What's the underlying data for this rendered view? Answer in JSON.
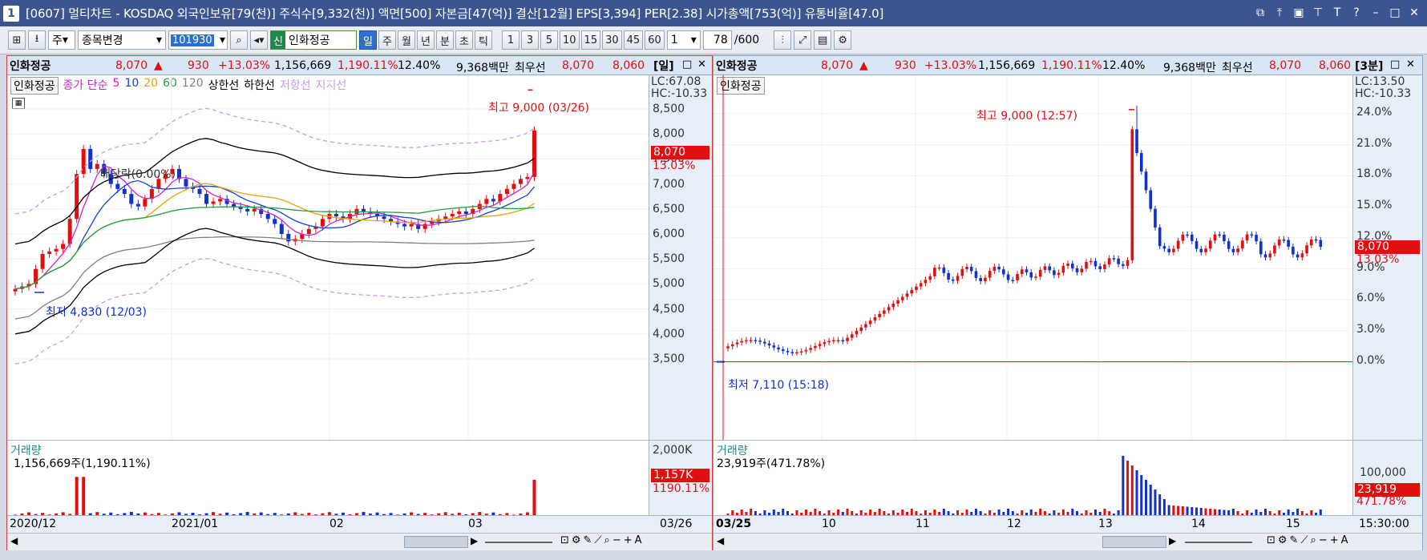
{
  "window": {
    "number": "1",
    "title": "[0607] 멀티차트 - KOSDAQ 외국인보유[79(천)] 주식수[9,332(천)] 액면[500] 자본금[47(억)] 결산[12월] EPS[3,394] PER[2.38] 시가총액[753(억)] 유통비율[47.0]"
  },
  "toolbar": {
    "unit": "주",
    "search_mode": "종목변경",
    "code": "101930",
    "stock_tag": "신",
    "stock_name": "인화정공",
    "periods": [
      "일",
      "주",
      "월",
      "년",
      "분",
      "초",
      "틱"
    ],
    "active_period": "일",
    "intervals": [
      "1",
      "3",
      "5",
      "10",
      "15",
      "30",
      "45",
      "60"
    ],
    "interval_value": "1",
    "count": "78",
    "count_total": "/600"
  },
  "left": {
    "info": {
      "name": "인화정공",
      "price": "8,070",
      "arrow": "▲",
      "change": "930",
      "change_pct": "+13.03%",
      "volume": "1,156,669",
      "volume_pct": "1,190.11%",
      "turnover": "12.40%",
      "amount": "9,368백만",
      "bid_label": "최우선",
      "ask": "8,070",
      "bid": "8,060",
      "period": "[일]"
    },
    "legend": {
      "name": "인화정공",
      "ma": "종가 단순",
      "ma5": "5",
      "ma10": "10",
      "ma20": "20",
      "ma60": "60",
      "ma120": "120",
      "upper": "상한선",
      "lower": "하한선",
      "resist": "저항선",
      "support": "지지선"
    },
    "high_label": "최고 9,000 (03/26)",
    "low_label": "최저 4,830 (12/03)",
    "dividend_label": "배당락(0.00%)",
    "lc": "LC:67.08",
    "hc": "HC:-10.33",
    "price_tag": "8,070",
    "pct_tag": "13.03%",
    "y_labels": [
      "8,500",
      "8,000",
      "7,500",
      "7,000",
      "6,500",
      "6,000",
      "5,500",
      "5,000",
      "4,500",
      "4,000",
      "3,500"
    ],
    "volume_title": "거래량",
    "volume_value": "1,156,669주(1,190.11%)",
    "vol_axis_top": "2,000K",
    "vol_tag": "1,157K",
    "vol_pct_tag": "1190.11%",
    "x_labels": [
      "2020/12",
      "2021/01",
      "02",
      "03"
    ],
    "x_end": "03/26"
  },
  "right": {
    "info": {
      "name": "인화정공",
      "price": "8,070",
      "arrow": "▲",
      "change": "930",
      "change_pct": "+13.03%",
      "volume": "1,156,669",
      "volume_pct": "1,190.11%",
      "turnover": "12.40%",
      "amount": "9,368백만",
      "bid_label": "최우선",
      "ask": "8,070",
      "bid": "8,060",
      "period": "[3분]"
    },
    "legend_name": "인화정공",
    "high_label": "최고 9,000 (12:57)",
    "low_label": "최저 7,110 (15:18)",
    "lc": "LC:13.50",
    "hc": "HC:-10.33",
    "price_tag": "8,070",
    "pct_tag": "13.03%",
    "y_labels": [
      "24.0%",
      "21.0%",
      "18.0%",
      "15.0%",
      "12.0%",
      "9.0%",
      "6.0%",
      "3.0%",
      "0.0%"
    ],
    "volume_title": "거래량",
    "volume_value": "23,919주(471.78%)",
    "vol_axis_top": "100,000",
    "vol_tag": "23,919",
    "vol_pct_tag": "471.78%",
    "x_labels": [
      "03/25",
      "10",
      "11",
      "12",
      "13",
      "14",
      "15"
    ],
    "x_end": "15:30:00"
  },
  "colors": {
    "up": "#e01010",
    "down": "#1030d0",
    "ma5": "#d020d0",
    "ma10": "#1040e0",
    "ma20": "#f0a000",
    "ma60": "#20a040",
    "ma120": "#808080",
    "band": "#000000",
    "envelope": "#c89be8"
  }
}
